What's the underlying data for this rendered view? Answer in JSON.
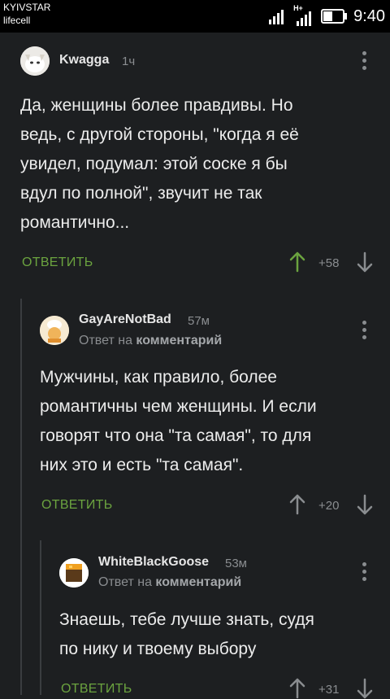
{
  "status_bar": {
    "carrier_1": "KYIVSTAR",
    "carrier_2": "lifecell",
    "network_label": "H+",
    "time": "9:40"
  },
  "comments": [
    {
      "author": "Kwagga",
      "time": "1ч",
      "reply_to_prefix": "",
      "reply_to_link": "",
      "body_lines": [
        "Да, женщины более правдивы. Но",
        "ведь, с другой стороны, \"когда я её",
        "увидел, подумал: этой соске я бы",
        "вдул по полной\", звучит не так",
        "романтично..."
      ],
      "reply_label": "ОТВЕТИТЬ",
      "score": "+58",
      "upvote_active": true
    },
    {
      "author": "GayAreNotBad",
      "time": "57м",
      "reply_to_prefix": "Ответ на",
      "reply_to_link": "комментарий",
      "body_lines": [
        "Мужчины, как правило, более",
        "романтичны чем женщины. И если",
        "говорят что она \"та самая\", то для",
        "них это и есть \"та самая\"."
      ],
      "reply_label": "ОТВЕТИТЬ",
      "score": "+20",
      "upvote_active": false
    },
    {
      "author": "WhiteBlackGoose",
      "time": "53м",
      "reply_to_prefix": "Ответ на",
      "reply_to_link": "комментарий",
      "body_lines": [
        "Знаешь, тебе лучше знать, судя",
        "по нику и твоему выбору"
      ],
      "reply_label": "ОТВЕТИТЬ",
      "score": "+31",
      "upvote_active": false
    }
  ],
  "colors": {
    "background": "#1d1f21",
    "accent_green": "#6ba33f",
    "muted": "#8a8d90"
  }
}
